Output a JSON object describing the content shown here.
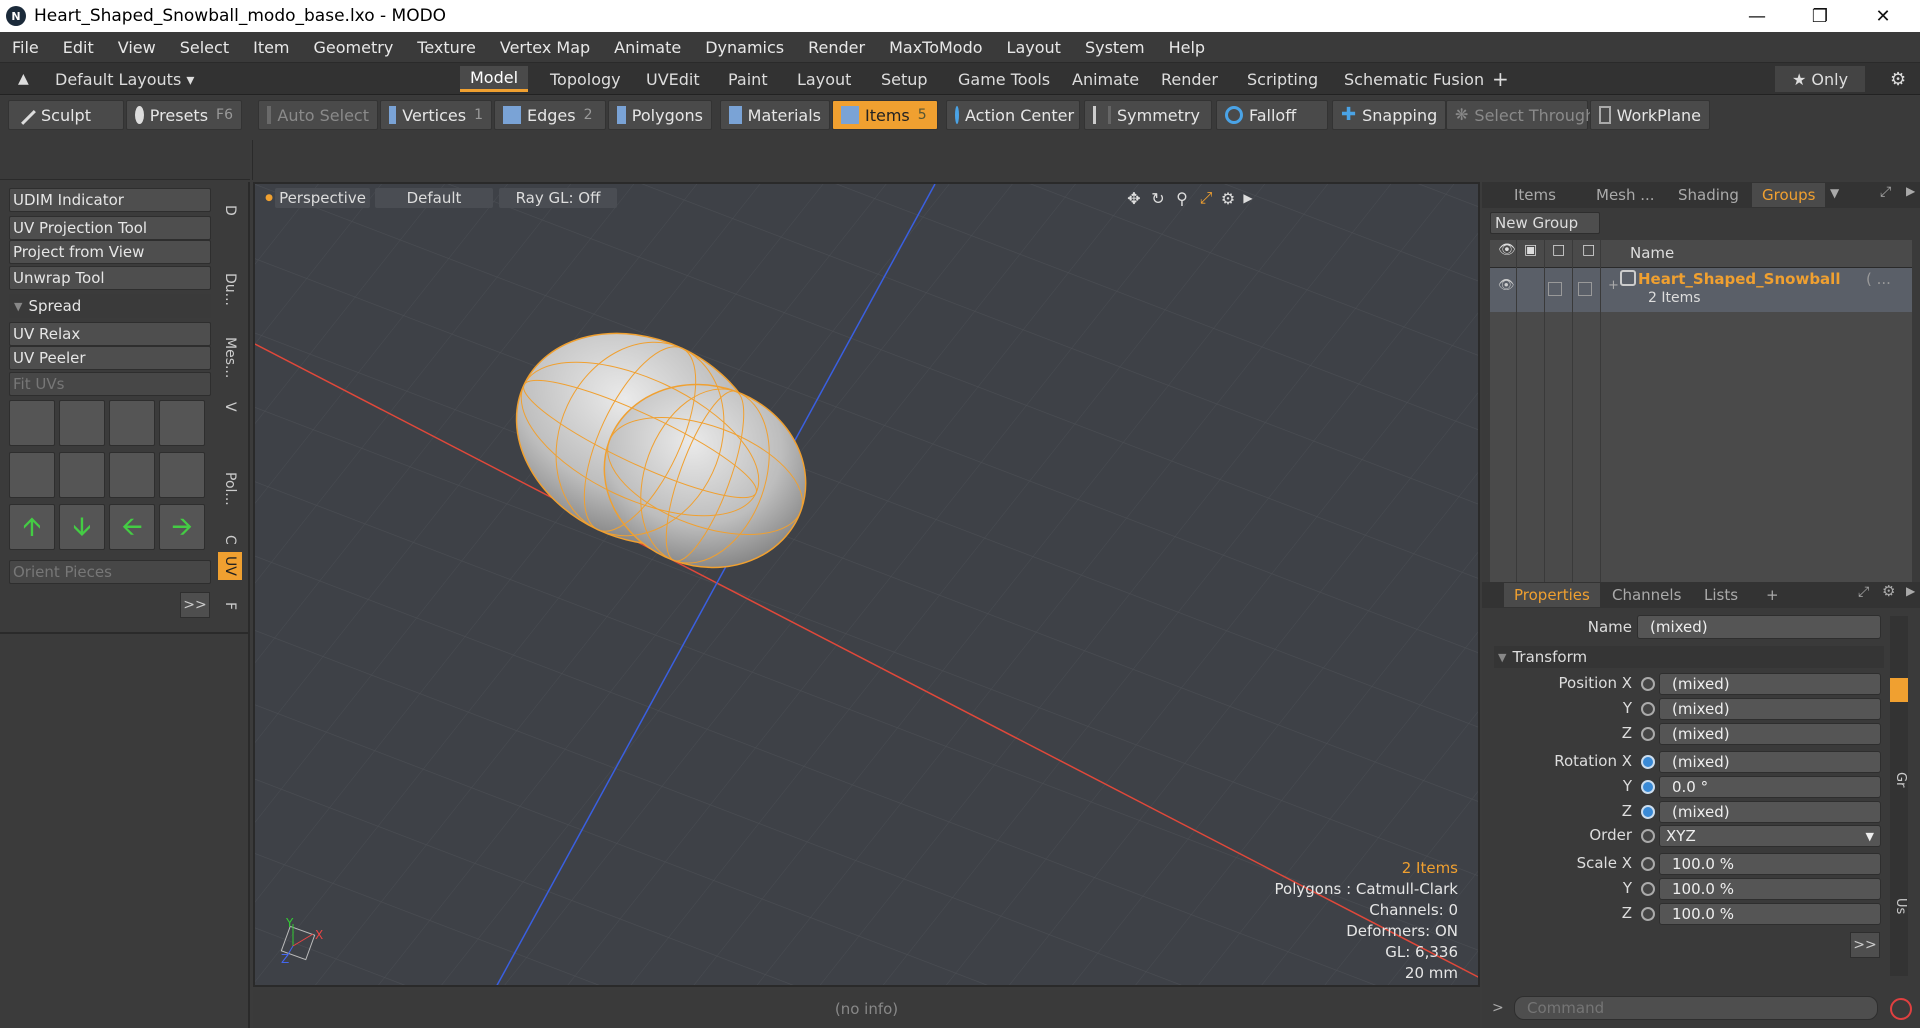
{
  "window": {
    "title": "Heart_Shaped_Snowball_modo_base.lxo - MODO",
    "app_logo": "N"
  },
  "menu": [
    "File",
    "Edit",
    "View",
    "Select",
    "Item",
    "Geometry",
    "Texture",
    "Vertex Map",
    "Animate",
    "Dynamics",
    "Render",
    "MaxToModo",
    "Layout",
    "System",
    "Help"
  ],
  "layout_bar": {
    "default_layouts": "Default Layouts ▾",
    "tabs": [
      "Model",
      "Topology",
      "UVEdit",
      "Paint",
      "Layout",
      "Setup",
      "Game Tools",
      "Animate",
      "Render",
      "Scripting",
      "Schematic Fusion"
    ],
    "active_tab": "Model",
    "only_label": "★  Only"
  },
  "toolbar": {
    "sculpt": "Sculpt",
    "presets": "Presets",
    "presets_key": "F6",
    "auto_select": "Auto Select",
    "vertices": "Vertices",
    "vertices_key": "1",
    "edges": "Edges",
    "edges_key": "2",
    "polygons": "Polygons",
    "materials": "Materials",
    "items": "Items",
    "items_key": "5",
    "action_center": "Action Center",
    "symmetry": "Symmetry",
    "falloff": "Falloff",
    "snapping": "Snapping",
    "select_through": "Select Through",
    "workplane": "WorkPlane"
  },
  "left_panel": {
    "udim": "UDIM Indicator",
    "uv_projection": "UV Projection Tool",
    "project_view": "Project from View",
    "unwrap": "Unwrap Tool",
    "spread": "Spread",
    "uv_relax": "UV Relax",
    "uv_peeler": "UV Peeler",
    "fit_uvs": "Fit UVs",
    "orient_pieces": "Orient Pieces",
    "more": ">>",
    "vtabs": [
      "D",
      "Du...",
      "Mes...",
      "V",
      "Pol...",
      "C",
      "UV",
      "F"
    ]
  },
  "viewport": {
    "view": "Perspective",
    "shading": "Default",
    "raygl": "Ray GL: Off",
    "stats": {
      "items": "2 Items",
      "polygons": "Polygons : Catmull-Clark",
      "channels": "Channels: 0",
      "deformers": "Deformers: ON",
      "gl": "GL: 6,336",
      "unit": "20 mm"
    },
    "axis_y": "Y",
    "axis_x": "X",
    "axis_z": "Z"
  },
  "status": "(no info)",
  "right_panel": {
    "tabs": [
      "Items",
      "Mesh ...",
      "Shading",
      "Groups"
    ],
    "active_tab": "Groups",
    "new_group": "New Group",
    "col_name": "Name",
    "group_name": "Heart_Shaped_Snowball",
    "group_suffix": "( ...",
    "group_count": "2 Items",
    "prop_tabs": [
      "Properties",
      "Channels",
      "Lists"
    ],
    "prop_add": "+",
    "name_label": "Name",
    "name_value": "(mixed)",
    "transform": "Transform",
    "rows": [
      {
        "label": "Position X",
        "value": "(mixed)"
      },
      {
        "label": "Y",
        "value": "(mixed)"
      },
      {
        "label": "Z",
        "value": "(mixed)"
      },
      {
        "label": "Rotation X",
        "value": "(mixed)"
      },
      {
        "label": "Y",
        "value": "0.0 °"
      },
      {
        "label": "Z",
        "value": "(mixed)"
      },
      {
        "label": "Order",
        "value": "XYZ"
      },
      {
        "label": "Scale X",
        "value": "100.0 %"
      },
      {
        "label": "Y",
        "value": "100.0 %"
      },
      {
        "label": "Z",
        "value": "100.0 %"
      }
    ],
    "more": ">>",
    "side_tabs": [
      "Gr",
      "Us"
    ],
    "command_placeholder": "Command",
    "command_prompt": ">"
  },
  "colors": {
    "accent": "#f0a030",
    "x_axis": "#e0483a",
    "z_axis": "#3a5fe0"
  }
}
